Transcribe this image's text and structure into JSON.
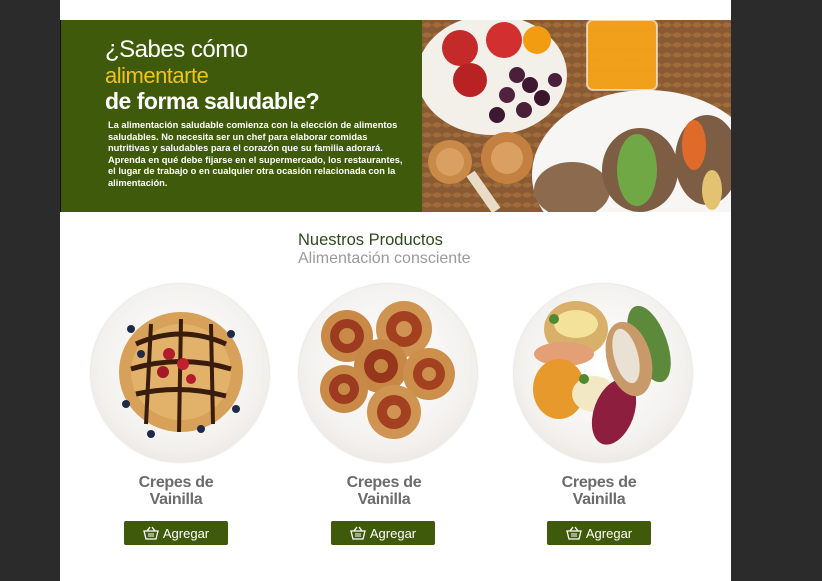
{
  "hero": {
    "title_line1": "¿Sabes cómo",
    "title_line2": "alimentarte",
    "title_line3": "de forma saludable?",
    "paragraph": "La alimentación saludable comienza con la elección de alimentos saludables. No necesita ser un chef para elaborar comidas nutritivas y saludables para el corazón que su familia adorará. Aprenda en qué debe fijarse en el supermercado, los restaurantes, el lugar de trabajo o en cualquier otra ocasión relacionada con la alimentación."
  },
  "products_section": {
    "title": "Nuestros Productos",
    "subtitle": "Alimentación consciente"
  },
  "products": [
    {
      "name_line1": "Crepes de",
      "name_line2": "Vainilla",
      "button_label": "Agregar"
    },
    {
      "name_line1": "Crepes de",
      "name_line2": "Vainilla",
      "button_label": "Agregar"
    },
    {
      "name_line1": "Crepes de",
      "name_line2": "Vainilla",
      "button_label": "Agregar"
    }
  ],
  "colors": {
    "brand_green": "#3f5a0b",
    "accent_yellow": "#f2c21b",
    "title_green": "#2e4a1c"
  }
}
